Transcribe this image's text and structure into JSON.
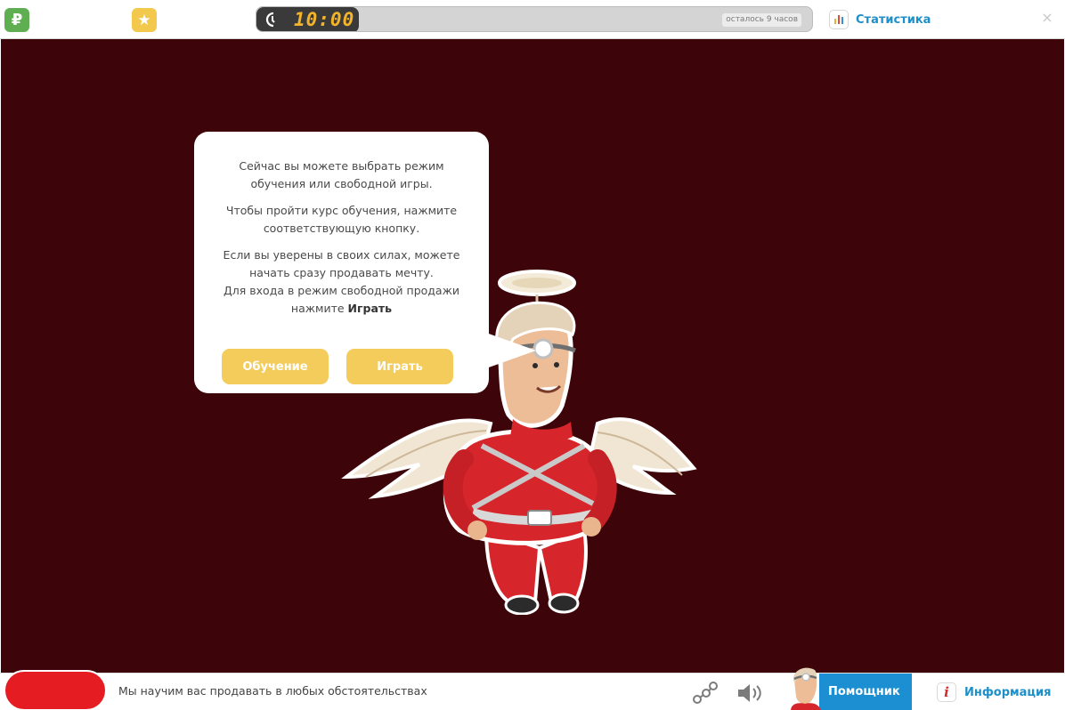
{
  "topbar": {
    "currency_symbol": "₽",
    "currency_icon": "ruble-icon",
    "favorite_icon": "star-icon",
    "timer": {
      "clock_icon": "clock-icon",
      "time": "10:00",
      "remaining": "осталось 9 часов"
    },
    "stats": {
      "icon": "bar-chart-icon",
      "label": "Статистика"
    },
    "close_symbol": "×"
  },
  "dialog": {
    "p1": "Сейчас вы можете выбрать режим обучения или свободной игры.",
    "p2": "Чтобы пройти курс обучения, нажмите соответствующую кнопку.",
    "p3_line1": "Если вы уверены в своих силах, можете начать сразу продавать мечту.",
    "p3_line2_prefix": "Для входа в режим свободной продажи нажмите",
    "p3_line2_bold": "Играть",
    "learn_button": "Обучение",
    "play_button": "Играть"
  },
  "bottombar": {
    "ticker": "Мы научим вас продавать в любых обстоятельствах",
    "share_icon": "share-icon",
    "sound_icon": "speaker-icon",
    "helper_label": "Помощник",
    "info_symbol": "i",
    "info_label": "Информация"
  },
  "colors": {
    "background": "#3d0409",
    "accent_yellow": "#f3cc5b",
    "link_blue": "#1d8fc9",
    "helper_blue": "#1b8fd2",
    "timer_digits": "#f3b42a",
    "ruble_green": "#5fae52",
    "star_yellow": "#f2c94c",
    "angel_red": "#d7262b"
  }
}
